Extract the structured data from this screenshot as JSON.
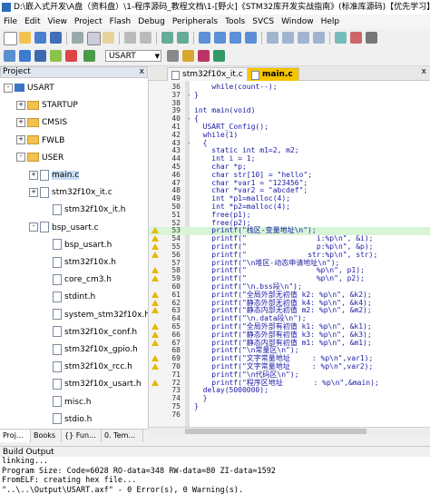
{
  "window_title": "D:\\嵌入式开发\\A盘（资料盘）\\1-程序源码_教程文档\\1-[野火]《STM32库开发实战指南》(标准库源码)【优先学习】\\1-书籍配",
  "menu": [
    "File",
    "Edit",
    "View",
    "Project",
    "Flash",
    "Debug",
    "Peripherals",
    "Tools",
    "SVCS",
    "Window",
    "Help"
  ],
  "toolbar": {
    "target": "USART"
  },
  "project_panel": {
    "title": "Project",
    "close": "x",
    "tree": [
      {
        "label": "USART",
        "kind": "root",
        "depth": 0,
        "exp": "-"
      },
      {
        "label": "STARTUP",
        "kind": "folder",
        "depth": 1,
        "exp": "+"
      },
      {
        "label": "CMSIS",
        "kind": "folder",
        "depth": 1,
        "exp": "+"
      },
      {
        "label": "FWLB",
        "kind": "folder",
        "depth": 1,
        "exp": "+"
      },
      {
        "label": "USER",
        "kind": "folder",
        "depth": 1,
        "exp": "-"
      },
      {
        "label": "main.c",
        "kind": "file",
        "depth": 2,
        "exp": "+",
        "selected": true
      },
      {
        "label": "stm32f10x_it.c",
        "kind": "file",
        "depth": 2,
        "exp": "+"
      },
      {
        "label": "stm32f10x_it.h",
        "kind": "file",
        "depth": 3,
        "exp": ""
      },
      {
        "label": "bsp_usart.c",
        "kind": "file",
        "depth": 2,
        "exp": "-"
      },
      {
        "label": "bsp_usart.h",
        "kind": "file",
        "depth": 3,
        "exp": ""
      },
      {
        "label": "stm32f10x.h",
        "kind": "file",
        "depth": 3,
        "exp": ""
      },
      {
        "label": "core_cm3.h",
        "kind": "file",
        "depth": 3,
        "exp": ""
      },
      {
        "label": "stdint.h",
        "kind": "file",
        "depth": 3,
        "exp": ""
      },
      {
        "label": "system_stm32f10x.h",
        "kind": "file",
        "depth": 3,
        "exp": ""
      },
      {
        "label": "stm32f10x_conf.h",
        "kind": "file",
        "depth": 3,
        "exp": ""
      },
      {
        "label": "stm32f10x_gpio.h",
        "kind": "file",
        "depth": 3,
        "exp": ""
      },
      {
        "label": "stm32f10x_rcc.h",
        "kind": "file",
        "depth": 3,
        "exp": ""
      },
      {
        "label": "stm32f10x_usart.h",
        "kind": "file",
        "depth": 3,
        "exp": ""
      },
      {
        "label": "misc.h",
        "kind": "file",
        "depth": 3,
        "exp": ""
      },
      {
        "label": "stdio.h",
        "kind": "file",
        "depth": 3,
        "exp": ""
      }
    ],
    "tabs": [
      "Proj...",
      "Books",
      "{} Fun...",
      "0. Tem..."
    ]
  },
  "editor": {
    "tabs": [
      {
        "label": "stm32f10x_it.c",
        "active": false
      },
      {
        "label": "main.c",
        "active": true
      }
    ],
    "close": "x",
    "lines": [
      {
        "n": "36",
        "f": "",
        "w": false,
        "hl": false,
        "t": "    while(count--);"
      },
      {
        "n": "37",
        "f": "-",
        "w": false,
        "hl": false,
        "t": "}"
      },
      {
        "n": "38",
        "f": "",
        "w": false,
        "hl": false,
        "t": ""
      },
      {
        "n": "39",
        "f": "",
        "w": false,
        "hl": false,
        "t": "int main(void)"
      },
      {
        "n": "40",
        "f": "-",
        "w": false,
        "hl": false,
        "t": "{"
      },
      {
        "n": "41",
        "f": "",
        "w": false,
        "hl": false,
        "t": "  USART_Config();"
      },
      {
        "n": "42",
        "f": "",
        "w": false,
        "hl": false,
        "t": "  while(1)"
      },
      {
        "n": "43",
        "f": "-",
        "w": false,
        "hl": false,
        "t": "  {"
      },
      {
        "n": "43",
        "f": "",
        "w": false,
        "hl": false,
        "t": "    static int m1=2, m2;"
      },
      {
        "n": "44",
        "f": "",
        "w": false,
        "hl": false,
        "t": "    int i = 1;"
      },
      {
        "n": "45",
        "f": "",
        "w": false,
        "hl": false,
        "t": "    char *p;"
      },
      {
        "n": "46",
        "f": "",
        "w": false,
        "hl": false,
        "t": "    char str[10] = \"hello\";"
      },
      {
        "n": "47",
        "f": "",
        "w": false,
        "hl": false,
        "t": "    char *var1 = \"123456\";"
      },
      {
        "n": "48",
        "f": "",
        "w": false,
        "hl": false,
        "t": "    char *var2 = \"abcdef\";"
      },
      {
        "n": "49",
        "f": "",
        "w": false,
        "hl": false,
        "t": "    int *p1=malloc(4);"
      },
      {
        "n": "50",
        "f": "",
        "w": false,
        "hl": false,
        "t": "    int *p2=malloc(4);"
      },
      {
        "n": "51",
        "f": "",
        "w": false,
        "hl": false,
        "t": "    free(p1);"
      },
      {
        "n": "52",
        "f": "",
        "w": false,
        "hl": false,
        "t": "    free(p2);"
      },
      {
        "n": "53",
        "f": "",
        "w": true,
        "hl": true,
        "t": "    printf(\"栈区-变量地址\\n\");"
      },
      {
        "n": "54",
        "f": "",
        "w": true,
        "hl": false,
        "t": "    printf(\"                i:%p\\n\", &i);"
      },
      {
        "n": "55",
        "f": "",
        "w": true,
        "hl": false,
        "t": "    printf(\"                p:%p\\n\", &p);"
      },
      {
        "n": "56",
        "f": "",
        "w": true,
        "hl": false,
        "t": "    printf(\"              str:%p\\n\", str);"
      },
      {
        "n": "57",
        "f": "",
        "w": false,
        "hl": false,
        "t": "    printf(\"\\n堆区-动态申请地址\\n\");"
      },
      {
        "n": "58",
        "f": "",
        "w": true,
        "hl": false,
        "t": "    printf(\"                %p\\n\", p1);"
      },
      {
        "n": "59",
        "f": "",
        "w": true,
        "hl": false,
        "t": "    printf(\"                %p\\n\", p2);"
      },
      {
        "n": "60",
        "f": "",
        "w": false,
        "hl": false,
        "t": "    printf(\"\\n.bss段\\n\");"
      },
      {
        "n": "61",
        "f": "",
        "w": true,
        "hl": false,
        "t": "    printf(\"全局外部无初值 k2: %p\\n\", &k2);"
      },
      {
        "n": "62",
        "f": "",
        "w": true,
        "hl": false,
        "t": "    printf(\"静态外部无初值 k4: %p\\n\", &k4);"
      },
      {
        "n": "63",
        "f": "",
        "w": true,
        "hl": false,
        "t": "    printf(\"静态内部无初值 m2: %p\\n\", &m2);"
      },
      {
        "n": "64",
        "f": "",
        "w": false,
        "hl": false,
        "t": "    printf(\"\\n.data段\\n\");"
      },
      {
        "n": "65",
        "f": "",
        "w": true,
        "hl": false,
        "t": "    printf(\"全局外部有初值 k1: %p\\n\", &k1);"
      },
      {
        "n": "66",
        "f": "",
        "w": true,
        "hl": false,
        "t": "    printf(\"静态外部有初值 k3: %p\\n\", &k3);"
      },
      {
        "n": "67",
        "f": "",
        "w": true,
        "hl": false,
        "t": "    printf(\"静态内部有初值 m1: %p\\n\", &m1);"
      },
      {
        "n": "68",
        "f": "",
        "w": false,
        "hl": false,
        "t": "    printf(\"\\n常量区\\n\");"
      },
      {
        "n": "69",
        "f": "",
        "w": true,
        "hl": false,
        "t": "    printf(\"文字常量地址     : %p\\n\",var1);"
      },
      {
        "n": "70",
        "f": "",
        "w": true,
        "hl": false,
        "t": "    printf(\"文字常量地址     : %p\\n\",var2);"
      },
      {
        "n": "71",
        "f": "",
        "w": false,
        "hl": false,
        "t": "    printf(\"\\n代码区\\n\");"
      },
      {
        "n": "72",
        "f": "",
        "w": true,
        "hl": false,
        "t": "    printf(\"程序区地址       : %p\\n\",&main);"
      },
      {
        "n": "73",
        "f": "",
        "w": false,
        "hl": false,
        "t": "  delay(5000000);"
      },
      {
        "n": "74",
        "f": "",
        "w": false,
        "hl": false,
        "t": "  }"
      },
      {
        "n": "75",
        "f": "",
        "w": false,
        "hl": false,
        "t": "}"
      },
      {
        "n": "76",
        "f": "",
        "w": false,
        "hl": false,
        "t": ""
      }
    ]
  },
  "build_output": {
    "title": "Build Output",
    "lines": [
      "linking...",
      "Program Size: Code=6028 RO-data=348 RW-data=80 ZI-data=1592",
      "FromELF: creating hex file...",
      "\"..\\..\\Output\\USART.axf\" - 0 Error(s), 0 Warning(s)."
    ]
  }
}
